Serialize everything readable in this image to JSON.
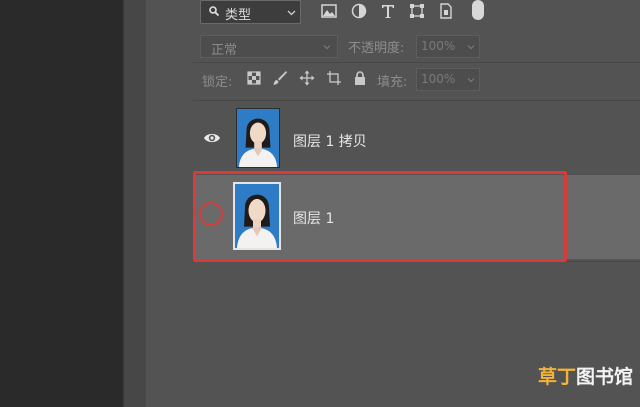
{
  "filter": {
    "kind_label": "类型"
  },
  "blend": {
    "mode": "正常",
    "opacity_label": "不透明度:",
    "opacity_value": "100%"
  },
  "lock": {
    "label": "锁定:",
    "fill_label": "填充:",
    "fill_value": "100%"
  },
  "layers": [
    {
      "name": "图层 1 拷贝",
      "visible": true,
      "selected": false
    },
    {
      "name": "图层 1",
      "visible": false,
      "selected": true
    }
  ],
  "watermark": {
    "part1": "草丁",
    "part2": "图书馆"
  },
  "colors": {
    "panel": "#535353",
    "selected_row": "#6a6a6a",
    "annotation": "#d93a3a",
    "photo_bg": "#2e7bc6"
  }
}
